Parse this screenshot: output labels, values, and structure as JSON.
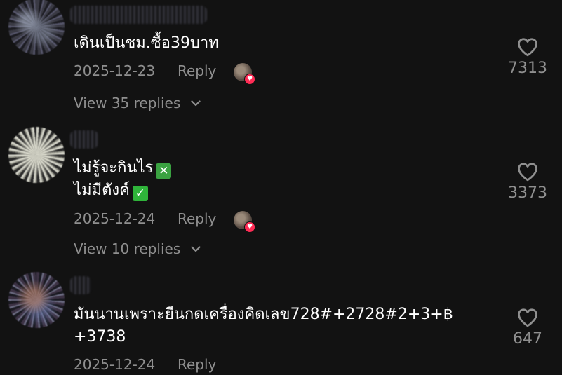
{
  "comments": [
    {
      "lines": [
        "เดินเป็นชม.ซื้อ39บาท"
      ],
      "date": "2025-12-23",
      "reply_label": "Reply",
      "creator_liked": true,
      "view_replies": "View 35 replies",
      "likes": "7313"
    },
    {
      "lines": [
        "ไม่รู้จะกินไร",
        "ไม่มีตังค์"
      ],
      "emojis": [
        "✕",
        "✓"
      ],
      "date": "2025-12-24",
      "reply_label": "Reply",
      "creator_liked": true,
      "view_replies": "View 10 replies",
      "likes": "3373"
    },
    {
      "lines": [
        "มันนานเพราะยืนกดเครื่องคิดเลข728#+2728#2+3+฿",
        "+3738"
      ],
      "date": "2025-12-24",
      "reply_label": "Reply",
      "likes": "647"
    }
  ],
  "icons": {
    "like": "heart-outline-icon",
    "expand": "chevron-down-icon",
    "creator_badge": "heart-badge-icon",
    "emoji_1": "cross-mark-button-emoji",
    "emoji_2": "check-mark-button-emoji"
  },
  "colors": {
    "background": "#121212",
    "text_primary": "#ffffff",
    "text_secondary": "#8f8f8f",
    "creator_badge": "#ff2c55",
    "emoji_green": "#3aa241"
  }
}
